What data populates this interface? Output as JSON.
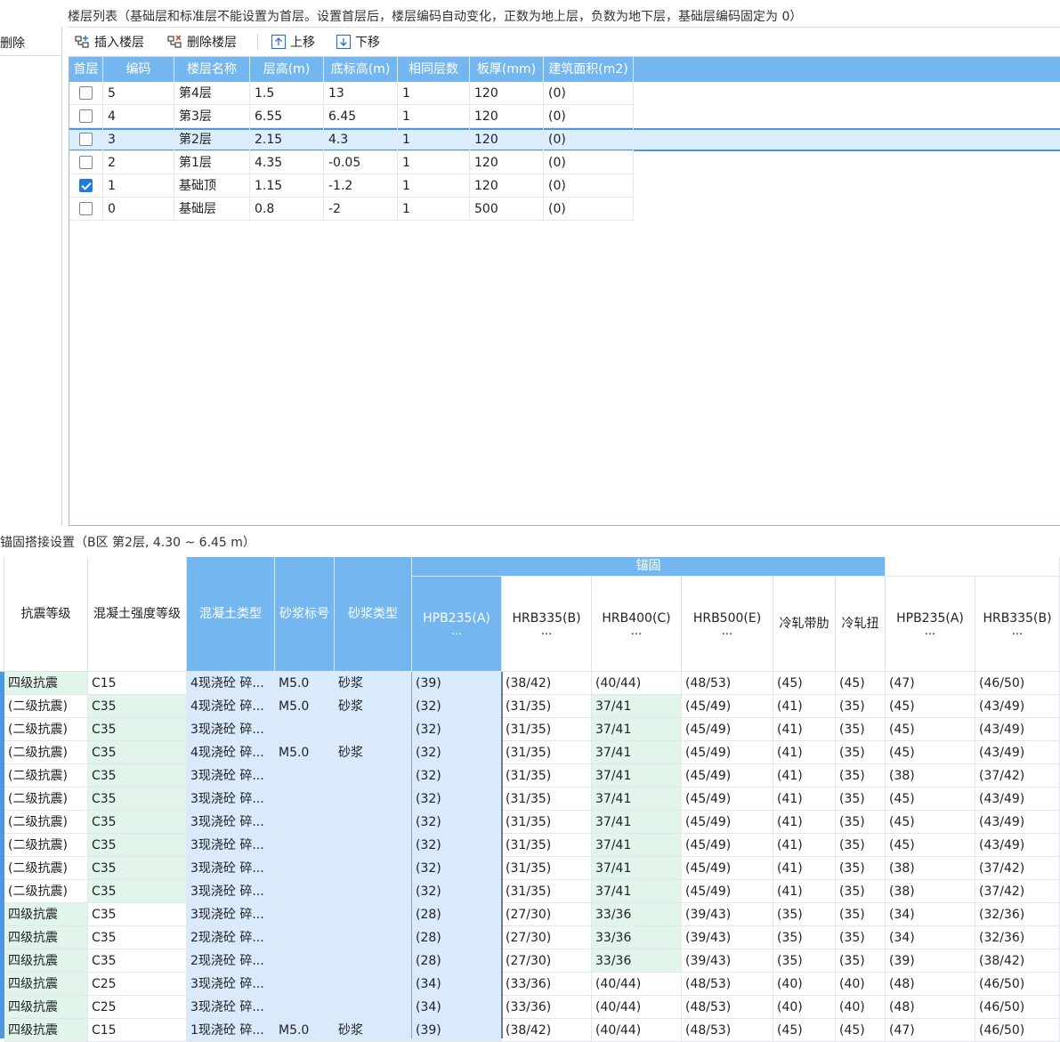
{
  "floor_list": {
    "title": "楼层列表（基础层和标准层不能设置为首层。设置首层后，楼层编码自动变化，正数为地上层，负数为地下层，基础层编码固定为 0）",
    "left_pane_delete_label": "删除",
    "toolbar": {
      "insert_label": "插入楼层",
      "delete_label": "删除楼层",
      "up_label": "上移",
      "down_label": "下移"
    },
    "columns": [
      "首层",
      "编码",
      "楼层名称",
      "层高(m)",
      "底标高(m)",
      "相同层数",
      "板厚(mm)",
      "建筑面积(m2)"
    ],
    "rows": [
      {
        "first": false,
        "code": "5",
        "name": "第4层",
        "height": "1.5",
        "bottom": "13",
        "same": "1",
        "thick": "120",
        "area": "(0)"
      },
      {
        "first": false,
        "code": "4",
        "name": "第3层",
        "height": "6.55",
        "bottom": "6.45",
        "same": "1",
        "thick": "120",
        "area": "(0)"
      },
      {
        "first": false,
        "code": "3",
        "name": "第2层",
        "height": "2.15",
        "bottom": "4.3",
        "same": "1",
        "thick": "120",
        "area": "(0)"
      },
      {
        "first": false,
        "code": "2",
        "name": "第1层",
        "height": "4.35",
        "bottom": "-0.05",
        "same": "1",
        "thick": "120",
        "area": "(0)"
      },
      {
        "first": true,
        "code": "1",
        "name": "基础顶",
        "height": "1.15",
        "bottom": "-1.2",
        "same": "1",
        "thick": "120",
        "area": "(0)"
      },
      {
        "first": false,
        "code": "0",
        "name": "基础层",
        "height": "0.8",
        "bottom": "-2",
        "same": "1",
        "thick": "500",
        "area": "(0)"
      }
    ],
    "selected_row_index": 2
  },
  "anchor_settings": {
    "title": "锚固搭接设置（B区  第2层, 4.30 ~ 6.45 m）",
    "group_header": "锚固",
    "columns": {
      "seismic": "抗震等级",
      "concrete_grade": "混凝土强度等级",
      "concrete_type": "混凝土类型",
      "mortar_grade": "砂浆标号",
      "mortar_type": "砂浆类型",
      "hpb235": "HPB235(A)",
      "hrb335": "HRB335(B)",
      "hrb400": "HRB400(C)",
      "hrb500": "HRB500(E)",
      "cold_ribbed": "冷轧带肋",
      "cold_twisted": "冷轧扭",
      "hpb235_lap": "HPB235(A)",
      "hrb335_lap": "HRB335(B)",
      "ellipsis": "..."
    },
    "rows": [
      [
        "四级抗震",
        "C15",
        "4现浇砼 碎...",
        "M5.0",
        "砂浆",
        "(39)",
        "(38/42)",
        "(40/44)",
        "(48/53)",
        "(45)",
        "(45)",
        "(47)",
        "(46/50)"
      ],
      [
        "(二级抗震)",
        "C35",
        "4现浇砼 碎...",
        "M5.0",
        "砂浆",
        "(32)",
        "(31/35)",
        "37/41",
        "(45/49)",
        "(41)",
        "(35)",
        "(45)",
        "(43/49)"
      ],
      [
        "(二级抗震)",
        "C35",
        "3现浇砼 碎...",
        "",
        "",
        "(32)",
        "(31/35)",
        "37/41",
        "(45/49)",
        "(41)",
        "(35)",
        "(45)",
        "(43/49)"
      ],
      [
        "(二级抗震)",
        "C35",
        "4现浇砼 碎...",
        "M5.0",
        "砂浆",
        "(32)",
        "(31/35)",
        "37/41",
        "(45/49)",
        "(41)",
        "(35)",
        "(45)",
        "(43/49)"
      ],
      [
        "(二级抗震)",
        "C35",
        "3现浇砼 碎...",
        "",
        "",
        "(32)",
        "(31/35)",
        "37/41",
        "(45/49)",
        "(41)",
        "(35)",
        "(38)",
        "(37/42)"
      ],
      [
        "(二级抗震)",
        "C35",
        "3现浇砼 碎...",
        "",
        "",
        "(32)",
        "(31/35)",
        "37/41",
        "(45/49)",
        "(41)",
        "(35)",
        "(45)",
        "(43/49)"
      ],
      [
        "(二级抗震)",
        "C35",
        "3现浇砼 碎...",
        "",
        "",
        "(32)",
        "(31/35)",
        "37/41",
        "(45/49)",
        "(41)",
        "(35)",
        "(45)",
        "(43/49)"
      ],
      [
        "(二级抗震)",
        "C35",
        "3现浇砼 碎...",
        "",
        "",
        "(32)",
        "(31/35)",
        "37/41",
        "(45/49)",
        "(41)",
        "(35)",
        "(45)",
        "(43/49)"
      ],
      [
        "(二级抗震)",
        "C35",
        "3现浇砼 碎...",
        "",
        "",
        "(32)",
        "(31/35)",
        "37/41",
        "(45/49)",
        "(41)",
        "(35)",
        "(38)",
        "(37/42)"
      ],
      [
        "(二级抗震)",
        "C35",
        "3现浇砼 碎...",
        "",
        "",
        "(32)",
        "(31/35)",
        "37/41",
        "(45/49)",
        "(41)",
        "(35)",
        "(38)",
        "(37/42)"
      ],
      [
        "四级抗震",
        "C35",
        "3现浇砼 碎...",
        "",
        "",
        "(28)",
        "(27/30)",
        "33/36",
        "(39/43)",
        "(35)",
        "(35)",
        "(34)",
        "(32/36)"
      ],
      [
        "四级抗震",
        "C35",
        "2现浇砼 碎...",
        "",
        "",
        "(28)",
        "(27/30)",
        "33/36",
        "(39/43)",
        "(35)",
        "(35)",
        "(34)",
        "(32/36)"
      ],
      [
        "四级抗震",
        "C35",
        "2现浇砼 碎...",
        "",
        "",
        "(28)",
        "(27/30)",
        "33/36",
        "(39/43)",
        "(35)",
        "(35)",
        "(39)",
        "(38/42)"
      ],
      [
        "四级抗震",
        "C25",
        "3现浇砼 碎...",
        "",
        "",
        "(34)",
        "(33/36)",
        "(40/44)",
        "(48/53)",
        "(40)",
        "(40)",
        "(48)",
        "(46/50)"
      ],
      [
        "四级抗震",
        "C25",
        "3现浇砼 碎...",
        "",
        "",
        "(34)",
        "(33/36)",
        "(40/44)",
        "(48/53)",
        "(40)",
        "(40)",
        "(48)",
        "(46/50)"
      ],
      [
        "四级抗震",
        "C15",
        "1现浇砼 碎...",
        "M5.0",
        "砂浆",
        "(39)",
        "(38/42)",
        "(40/44)",
        "(48/53)",
        "(45)",
        "(45)",
        "(47)",
        "(46/50)"
      ]
    ]
  }
}
